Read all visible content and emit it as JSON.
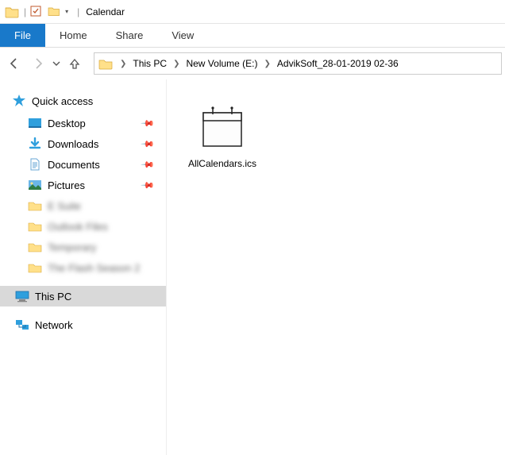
{
  "window": {
    "title": "Calendar"
  },
  "menubar": {
    "file": "File",
    "tabs": [
      "Home",
      "Share",
      "View"
    ]
  },
  "breadcrumb": {
    "items": [
      "This PC",
      "New Volume (E:)",
      "AdvikSoft_28-01-2019 02-36"
    ]
  },
  "sidebar": {
    "quick_access": {
      "label": "Quick access",
      "items": [
        {
          "label": "Desktop",
          "pinned": true,
          "icon": "desktop"
        },
        {
          "label": "Downloads",
          "pinned": true,
          "icon": "download"
        },
        {
          "label": "Documents",
          "pinned": true,
          "icon": "document"
        },
        {
          "label": "Pictures",
          "pinned": true,
          "icon": "pictures"
        },
        {
          "label": "E Suite",
          "pinned": false,
          "icon": "folder",
          "obscured": true
        },
        {
          "label": "Outlook Files",
          "pinned": false,
          "icon": "folder",
          "obscured": true
        },
        {
          "label": "Temporary",
          "pinned": false,
          "icon": "folder",
          "obscured": true
        },
        {
          "label": "The Flash Season 2",
          "pinned": false,
          "icon": "folder",
          "obscured": true
        }
      ]
    },
    "this_pc": {
      "label": "This PC"
    },
    "network": {
      "label": "Network"
    }
  },
  "files": [
    {
      "name": "AllCalendars.ics",
      "icon": "calendar"
    }
  ]
}
